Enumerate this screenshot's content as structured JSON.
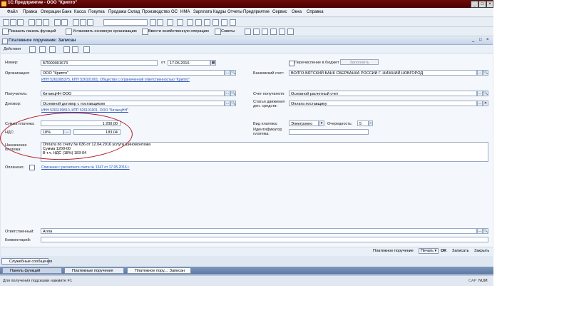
{
  "window": {
    "title": "1С:Предприятие - ООО \"Крипто\""
  },
  "menu": [
    "Файл",
    "Правка",
    "Операции",
    "Банк",
    "Касса",
    "Покупка",
    "Продажа",
    "Склад",
    "Производство",
    "ОС",
    "НМА",
    "Зарплата",
    "Кадры",
    "Отчеты",
    "Предприятие",
    "Сервис",
    "Окна",
    "Справка"
  ],
  "toolbar2": {
    "panel_label": "Показать панель функций",
    "org_label": "Установить основную организацию",
    "enter_op_label": "Ввести хозяйственную операцию",
    "tips_label": "Советы"
  },
  "doc": {
    "title": "Платежное поручение: Записан",
    "actions_label": "Действия",
    "number_label": "Номер:",
    "number": "БП000001673",
    "date_label": "от",
    "date": "17.05.2016",
    "budget_label": "Перечисление в бюджет",
    "fill_label": "Заполнить",
    "org_label": "Организация:",
    "org": "ООО \"Крипто\"",
    "org_link": "ИНН 5261085375, КПП 526101001, Общество с ограниченной ответственностью \"Крипто\"",
    "bank_account_label": "Банковский счет:",
    "bank_account": "ВОЛГО-ВЯТСКИЙ БАНК СБЕРБАНКА РОССИИ Г. НИЖНИЙ НОВГОРОД",
    "payee_label": "Получатель:",
    "payee": "КитаецНН ООО",
    "payee_account_label": "Счет получателя:",
    "payee_account": "Основной расчетный счет",
    "contract_label": "Договор:",
    "contract": "Основной договор с поставщиком",
    "cashflow_label": "Статья движения ден. средств:",
    "cashflow": "Оплата поставщику",
    "payee_link": "ИНН 5261109810, КПП 526101001, ООО \"КитаецНН\"",
    "sum_label": "Сумма платежа:",
    "sum": "1 200,00",
    "vat_label": "НДС:",
    "vat_rate": "18%",
    "vat_sum": "183,04",
    "pay_type_label": "Вид платежа:",
    "pay_type": "Электронно",
    "priority_label": "Очередность:",
    "priority": "5",
    "ident_label": "Идентификатор платежа:",
    "purpose_label": "Назначение платежа:",
    "purpose_lines": [
      "Оплата по счету № 636 от 12.04.2016 услуги шиномонтажа",
      "Сумма 1200-00",
      "В т.ч. НДС (18%) 183-04"
    ],
    "paid_label": "Оплачено:",
    "paid_link": "Списание с расчетного счета № 1347 от 17.05.2016 г.",
    "responsible_label": "Ответственный:",
    "responsible": "Алла",
    "comment_label": "Комментарий:",
    "comment": ""
  },
  "bottom": {
    "doc_label": "Платежное поручение",
    "print": "Печать",
    "ok": "OK",
    "save": "Записать",
    "close": "Закрыть"
  },
  "service_msgs": "Служебные сообщения",
  "taskbar": [
    "Панель функций",
    "Платежные поручения",
    "Платежное пору...: Записан"
  ],
  "status": {
    "hint": "Для получения подсказки нажмите F1",
    "caps": "CAP",
    "num": "NUM"
  }
}
